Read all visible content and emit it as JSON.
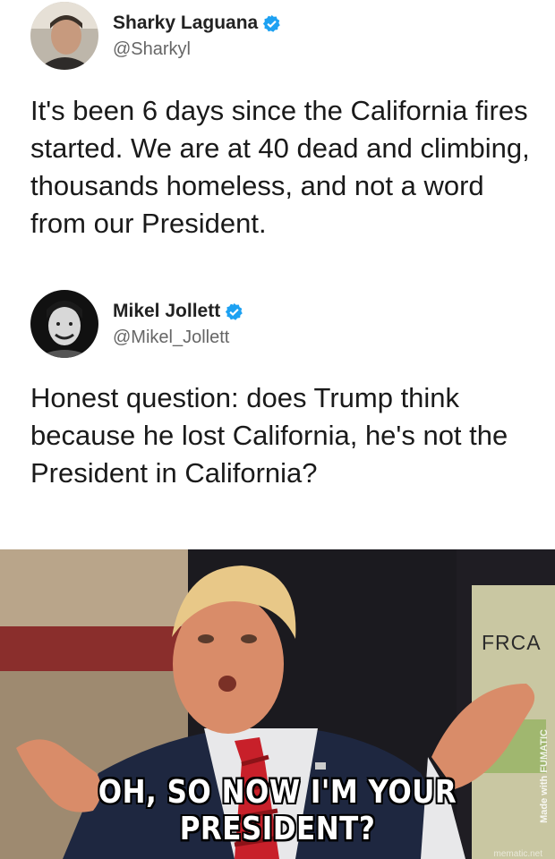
{
  "tweet1": {
    "display_name": "Sharky Laguana",
    "handle": "@Sharkyl",
    "text": "It's been 6 days since the California fires started. We are at 40 dead and climbing, thousands homeless, and not a word from our President."
  },
  "tweet2": {
    "display_name": "Mikel Jollett",
    "handle": "@Mikel_Jollett",
    "text": "Honest question: does Trump think because he lost California, he's not the President in California?"
  },
  "meme": {
    "caption": "OH, SO NOW I'M YOUR PRESIDENT?",
    "sign_text": "FRCA",
    "watermark": "Made with FUMATIC",
    "watermark_bottom": "mematic.net"
  },
  "colors": {
    "verified": "#1da1f2",
    "tie": "#c8202a",
    "suit": "#1e2740"
  }
}
